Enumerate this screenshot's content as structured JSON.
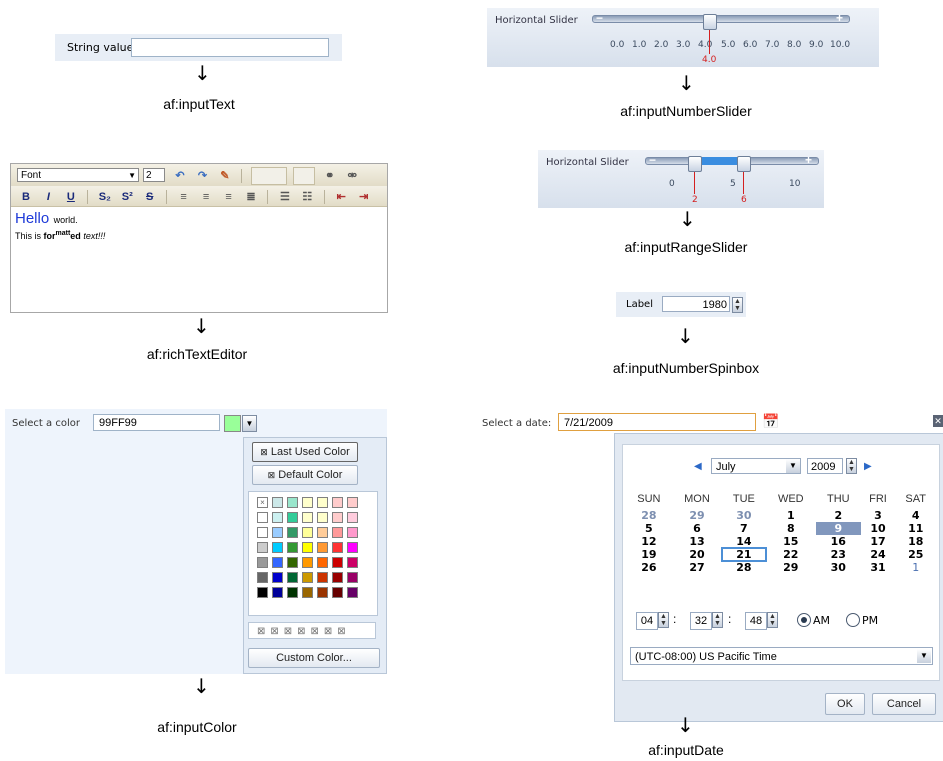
{
  "input_text": {
    "label": "String value",
    "value": "",
    "caption": "af:inputText"
  },
  "number_slider": {
    "label": "Horizontal Slider",
    "ticks": [
      "0.0",
      "1.0",
      "2.0",
      "3.0",
      "4.0",
      "5.0",
      "6.0",
      "7.0",
      "8.0",
      "9.0",
      "10.0"
    ],
    "value": "4.0",
    "caption": "af:inputNumberSlider"
  },
  "rich_text_editor": {
    "font_select": "Font",
    "size_select": "2",
    "content_line1_big": "Hello",
    "content_line1_rest": "world.",
    "content_line2_prefix": "This is ",
    "content_line2_for": "for",
    "content_line2_matt": "matt",
    "content_line2_ed": "ed",
    "content_line2_text": "text!!!",
    "caption": "af:richTextEditor"
  },
  "range_slider": {
    "label": "Horizontal Slider",
    "ticks": [
      "0",
      "5",
      "10"
    ],
    "low_value": "2",
    "high_value": "6",
    "caption": "af:inputRangeSlider"
  },
  "spinbox": {
    "label": "Label",
    "value": "1980",
    "caption": "af:inputNumberSpinbox"
  },
  "color": {
    "label": "Select a color",
    "value": "99FF99",
    "swatch_color": "#99ff99",
    "last_used_label": "Last Used Color",
    "default_label": "Default Color",
    "custom_label": "Custom Color...",
    "palette": [
      [
        "none",
        "#cce8e8",
        "#99e6cc",
        "#ffffcc",
        "#ffffcc",
        "#ffcccc",
        "#ffcccc"
      ],
      [
        "#ffffff",
        "#ccf0f0",
        "#33cc99",
        "#ffffcc",
        "#ffffcc",
        "#ffcccc",
        "#ffccdd"
      ],
      [
        "#ffffff",
        "#99ccff",
        "#339966",
        "#ffff99",
        "#ffcc99",
        "#ff9999",
        "#ff99cc"
      ],
      [
        "#cccccc",
        "#00ccff",
        "#339933",
        "#ffff00",
        "#ff9933",
        "#ff3333",
        "#ff00ff"
      ],
      [
        "#999999",
        "#3366ff",
        "#336600",
        "#ff9900",
        "#ff6600",
        "#cc0000",
        "#cc0066"
      ],
      [
        "#666666",
        "#0000cc",
        "#006633",
        "#cc9900",
        "#cc3300",
        "#990000",
        "#990066"
      ],
      [
        "#000000",
        "#000099",
        "#003300",
        "#996600",
        "#993300",
        "#660000",
        "#660066"
      ]
    ],
    "caption": "af:inputColor"
  },
  "date": {
    "label": "Select a date:",
    "value": "7/21/2009",
    "month": "July",
    "year": "2009",
    "weekdays": [
      "SUN",
      "MON",
      "TUE",
      "WED",
      "THU",
      "FRI",
      "SAT"
    ],
    "weeks": [
      [
        "28",
        "29",
        "30",
        "1",
        "2",
        "3",
        "4"
      ],
      [
        "5",
        "6",
        "7",
        "8",
        "9",
        "10",
        "11"
      ],
      [
        "12",
        "13",
        "14",
        "15",
        "16",
        "17",
        "18"
      ],
      [
        "19",
        "20",
        "21",
        "22",
        "23",
        "24",
        "25"
      ],
      [
        "26",
        "27",
        "28",
        "29",
        "30",
        "31",
        "1"
      ]
    ],
    "hour": "04",
    "minute": "32",
    "second": "48",
    "am_label": "AM",
    "pm_label": "PM",
    "timezone": "(UTC-08:00) US Pacific Time",
    "ok_label": "OK",
    "cancel_label": "Cancel",
    "caption": "af:inputDate"
  }
}
